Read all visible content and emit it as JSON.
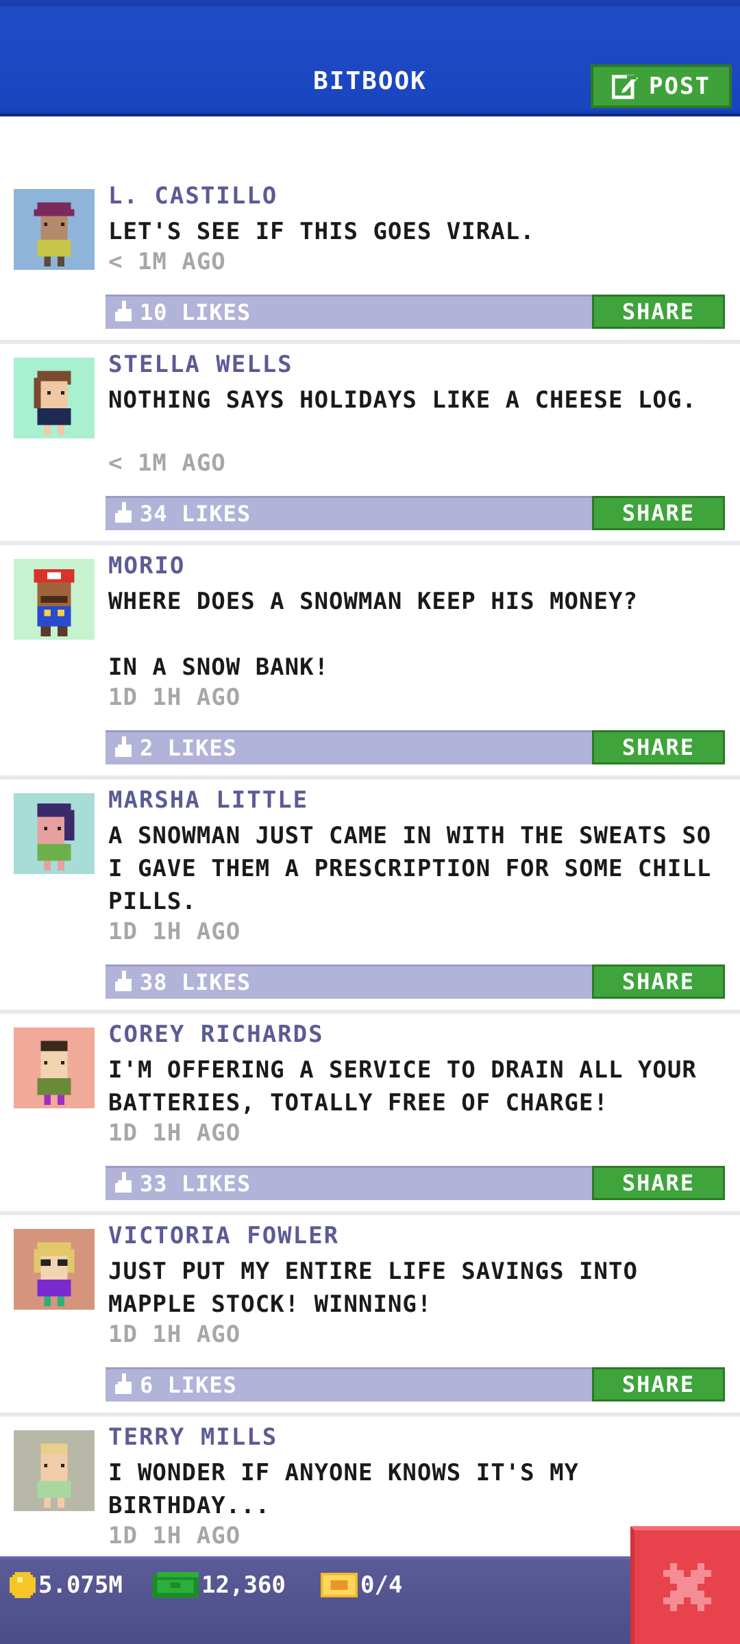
{
  "header": {
    "title": "BITBOOK",
    "post_label": "POST",
    "post_icon": "compose-icon",
    "bg_color": "#1a45c0"
  },
  "posts": [
    {
      "author": "L. CASTILLO",
      "text": "LET'S SEE IF THIS GOES VIRAL.",
      "time": "< 1M AGO",
      "likes": "10 LIKES",
      "share": "SHARE"
    },
    {
      "author": "STELLA WELLS",
      "text": "NOTHING SAYS HOLIDAYS LIKE A CHEESE LOG.",
      "time": "< 1M AGO",
      "likes": "34 LIKES",
      "share": "SHARE"
    },
    {
      "author": "MORIO",
      "text": "WHERE DOES A SNOWMAN KEEP HIS MONEY?\n\nIN A SNOW BANK!",
      "time": "1D 1H AGO",
      "likes": "2 LIKES",
      "share": "SHARE"
    },
    {
      "author": "MARSHA LITTLE",
      "text": "A SNOWMAN JUST CAME IN WITH THE SWEATS SO I GAVE THEM A PRESCRIPTION FOR SOME CHILL PILLS.",
      "time": "1D 1H AGO",
      "likes": "38 LIKES",
      "share": "SHARE"
    },
    {
      "author": "COREY RICHARDS",
      "text": "I'M OFFERING A SERVICE TO DRAIN ALL YOUR BATTERIES, TOTALLY FREE OF CHARGE!",
      "time": "1D 1H AGO",
      "likes": "33 LIKES",
      "share": "SHARE"
    },
    {
      "author": "VICTORIA FOWLER",
      "text": "JUST PUT MY ENTIRE LIFE SAVINGS INTO MAPPLE STOCK! WINNING!",
      "time": "1D 1H AGO",
      "likes": "6 LIKES",
      "share": "SHARE"
    },
    {
      "author": "TERRY MILLS",
      "text": "I WONDER IF ANYONE KNOWS IT'S MY BIRTHDAY...",
      "time": "1D 1H AGO",
      "likes": "",
      "share": ""
    }
  ],
  "status": {
    "coins": "5.075M",
    "coin_icon": "coin-icon",
    "bux": "12,360",
    "bux_icon": "cash-icon",
    "tickets": "0/4",
    "ticket_icon": "ticket-icon"
  },
  "close_icon": "close-icon",
  "colors": {
    "accent_green": "#3ea43b",
    "likes_bar": "#b2b3d9",
    "author": "#5b5b96",
    "close_red": "#e8424c"
  }
}
